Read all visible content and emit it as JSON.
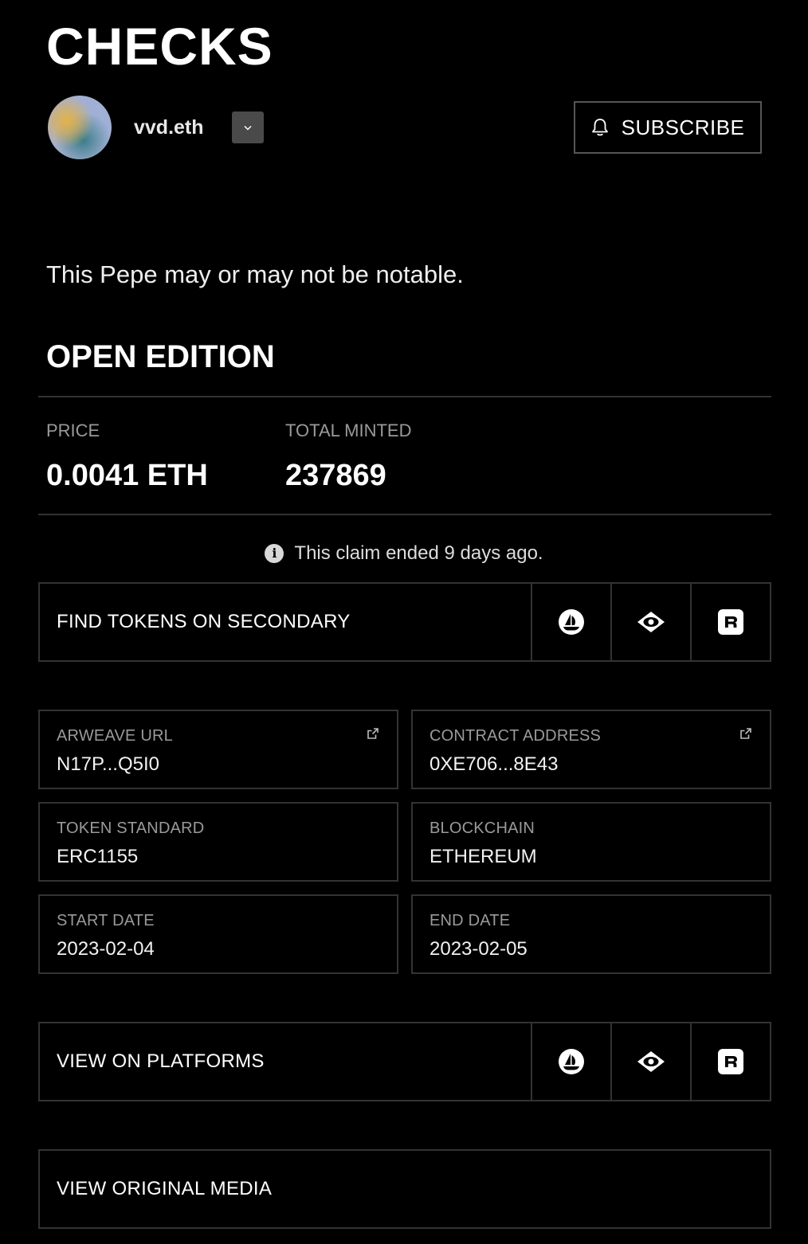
{
  "header": {
    "title": "CHECKS",
    "username": "vvd.eth",
    "subscribe_label": "SUBSCRIBE"
  },
  "description": "This Pepe may or may not be notable.",
  "edition": {
    "title": "OPEN EDITION",
    "price_label": "PRICE",
    "price_value": "0.0041 ETH",
    "minted_label": "TOTAL MINTED",
    "minted_value": "237869",
    "claim_note": "This claim ended 9 days ago."
  },
  "secondary": {
    "label": "FIND TOKENS ON SECONDARY",
    "icons": [
      "opensea-icon",
      "looksrare-icon",
      "rarible-icon"
    ]
  },
  "details": {
    "arweave_label": "ARWEAVE URL",
    "arweave_value": "N17P...Q5I0",
    "contract_label": "CONTRACT ADDRESS",
    "contract_value": "0XE706...8E43",
    "standard_label": "TOKEN STANDARD",
    "standard_value": "ERC1155",
    "chain_label": "BLOCKCHAIN",
    "chain_value": "ETHEREUM",
    "start_label": "START DATE",
    "start_value": "2023-02-04",
    "end_label": "END DATE",
    "end_value": "2023-02-05"
  },
  "platforms": {
    "label": "VIEW ON PLATFORMS"
  },
  "original_media": {
    "label": "VIEW ORIGINAL MEDIA"
  },
  "colors": {
    "background": "#000000",
    "border": "#333333",
    "muted_text": "#9a9a9a"
  }
}
